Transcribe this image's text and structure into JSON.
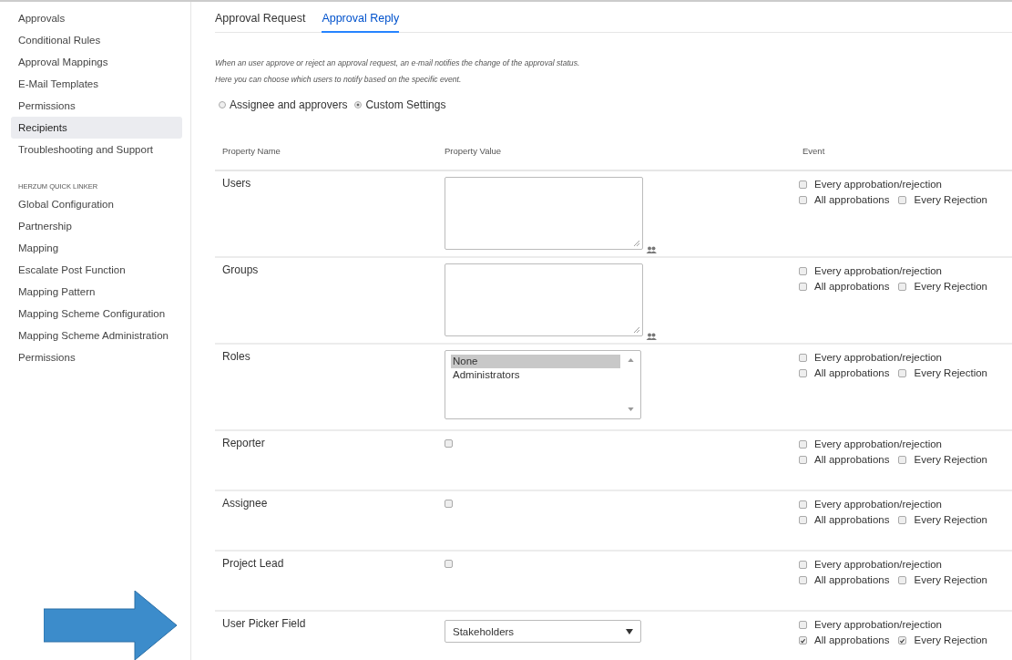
{
  "sidebar": {
    "items": [
      {
        "label": "Approvals",
        "selected": false
      },
      {
        "label": "Conditional Rules",
        "selected": false
      },
      {
        "label": "Approval Mappings",
        "selected": false
      },
      {
        "label": "E-Mail Templates",
        "selected": false
      },
      {
        "label": "Permissions",
        "selected": false
      },
      {
        "label": "Recipients",
        "selected": true
      },
      {
        "label": "Troubleshooting and Support",
        "selected": false
      }
    ],
    "section_heading": "HERZUM QUICK LINKER",
    "section_items": [
      {
        "label": "Global Configuration",
        "selected": false
      },
      {
        "label": "Partnership",
        "selected": false
      },
      {
        "label": "Mapping",
        "selected": false
      },
      {
        "label": "Escalate Post Function",
        "selected": false
      },
      {
        "label": "Mapping Pattern",
        "selected": false
      },
      {
        "label": "Mapping Scheme Configuration",
        "selected": false
      },
      {
        "label": "Mapping Scheme Administration",
        "selected": false
      },
      {
        "label": "Permissions",
        "selected": false
      }
    ]
  },
  "tabs": [
    {
      "label": "Approval Request",
      "selected": false
    },
    {
      "label": "Approval Reply",
      "selected": true
    }
  ],
  "description": [
    "When an user approve or reject an approval request, an e-mail notifies the change of the approval status.",
    "Here you can choose which users to notify based on the specific event."
  ],
  "mode_options": [
    {
      "label": "Assignee and approvers",
      "selected": false
    },
    {
      "label": "Custom Settings",
      "selected": true
    }
  ],
  "table": {
    "columns": [
      "Property Name",
      "Property Value",
      "Event"
    ],
    "rows": [
      {
        "name": "Users",
        "kind": "textarea",
        "events": [
          {
            "label": "Every approbation/rejection",
            "checked": false
          },
          {
            "label": "All approbations",
            "checked": false
          },
          {
            "label": "Every Rejection",
            "checked": false
          }
        ]
      },
      {
        "name": "Groups",
        "kind": "textarea",
        "events": [
          {
            "label": "Every approbation/rejection",
            "checked": false
          },
          {
            "label": "All approbations",
            "checked": false
          },
          {
            "label": "Every Rejection",
            "checked": false
          }
        ]
      },
      {
        "name": "Roles",
        "kind": "listbox",
        "options": [
          {
            "label": "None",
            "selected": true
          },
          {
            "label": "Administrators",
            "selected": false
          }
        ],
        "events": [
          {
            "label": "Every approbation/rejection",
            "checked": false
          },
          {
            "label": "All approbations",
            "checked": false
          },
          {
            "label": "Every Rejection",
            "checked": false
          }
        ]
      },
      {
        "name": "Reporter",
        "kind": "checkbox",
        "checked": false,
        "events": [
          {
            "label": "Every approbation/rejection",
            "checked": false
          },
          {
            "label": "All approbations",
            "checked": false
          },
          {
            "label": "Every Rejection",
            "checked": false
          }
        ]
      },
      {
        "name": "Assignee",
        "kind": "checkbox",
        "checked": false,
        "events": [
          {
            "label": "Every approbation/rejection",
            "checked": false
          },
          {
            "label": "All approbations",
            "checked": false
          },
          {
            "label": "Every Rejection",
            "checked": false
          }
        ]
      },
      {
        "name": "Project Lead",
        "kind": "checkbox",
        "checked": false,
        "events": [
          {
            "label": "Every approbation/rejection",
            "checked": false
          },
          {
            "label": "All approbations",
            "checked": false
          },
          {
            "label": "Every Rejection",
            "checked": false
          }
        ]
      },
      {
        "name": "User Picker Field",
        "kind": "select",
        "value": "Stakeholders",
        "events": [
          {
            "label": "Every approbation/rejection",
            "checked": false
          },
          {
            "label": "All approbations",
            "checked": true
          },
          {
            "label": "Every Rejection",
            "checked": true
          }
        ]
      }
    ]
  }
}
